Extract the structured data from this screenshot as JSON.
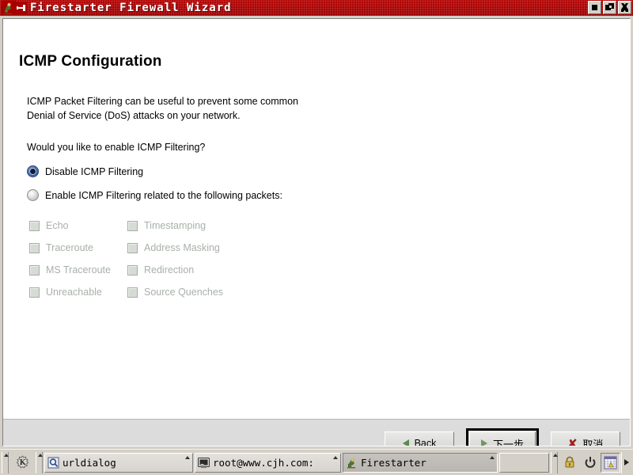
{
  "window": {
    "title": "Firestarter Firewall Wizard",
    "title_icon": "firestarter-icon",
    "pin_icon": "pin-icon",
    "buttons": {
      "minimize": "minimize-icon",
      "maximize": "maximize-icon",
      "close": "close-icon"
    }
  },
  "page": {
    "heading": "ICMP Configuration",
    "description_line_1": "ICMP Packet Filtering can be useful to prevent some common",
    "description_line_2": "Denial of Service (DoS) attacks on your network.",
    "question": "Would you like to enable ICMP Filtering?"
  },
  "radios": [
    {
      "label": "Disable ICMP Filtering",
      "selected": true
    },
    {
      "label": "Enable ICMP Filtering related to the following packets:",
      "selected": false
    }
  ],
  "packet_checkboxes": {
    "enabled": false,
    "rows": [
      {
        "col1": "Echo",
        "col2": "Timestamping"
      },
      {
        "col1": "Traceroute",
        "col2": "Address Masking"
      },
      {
        "col1": "MS Traceroute",
        "col2": "Redirection"
      },
      {
        "col1": "Unreachable",
        "col2": "Source Quenches"
      }
    ]
  },
  "buttons": {
    "back": {
      "label": "Back",
      "icon": "triangle-left-icon"
    },
    "next": {
      "label": "下一步",
      "icon": "triangle-right-icon",
      "is_default": true
    },
    "cancel": {
      "label": "取消",
      "icon": "x-mark-icon"
    }
  },
  "taskbar": {
    "kde_icon": "kde-gear-icon",
    "tasks": [
      {
        "label": "urldialog",
        "icon": "search-window-icon",
        "active": false
      },
      {
        "label": "root@www.cjh.com:",
        "icon": "terminal-icon",
        "active": false
      },
      {
        "label": "Firestarter",
        "icon": "firestarter-icon",
        "active": true
      }
    ],
    "tray": [
      {
        "name": "lock-icon"
      },
      {
        "name": "power-icon"
      },
      {
        "name": "keyboard-layout-icon"
      }
    ],
    "expand_icon": "triangle-right-icon"
  },
  "colors": {
    "titlebar": "#a80000",
    "window_face": "#d4d0c8",
    "button_bar": "#dcdcdc",
    "client": "#ffffff",
    "radio_selected": "#2a53a0",
    "disabled_text": "#a9b0a9",
    "cancel_icon": "#a02020",
    "next_icon": "#6f9a5e"
  }
}
